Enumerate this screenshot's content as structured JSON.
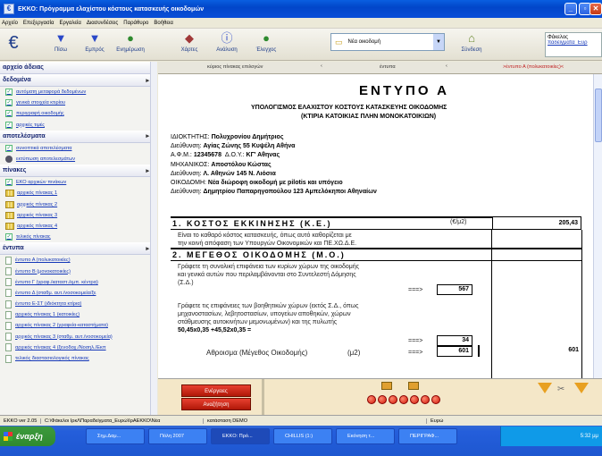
{
  "window": {
    "title": "ΕΚΚΟ: Πρόγραμμα ελαχίστου κόστους κατασκευής οικοδομών"
  },
  "menu": [
    "Αρχείο",
    "Επεξεργασία",
    "Εργαλεία",
    "Διασυνδέσεις",
    "Παράθυρο",
    "Βοήθεια"
  ],
  "toolbar": {
    "buttons": [
      {
        "label": "Πίσω",
        "icon": "back-arrow-icon"
      },
      {
        "label": "Εμπρός",
        "icon": "forward-arrow-icon"
      },
      {
        "label": "Ενημέρωση",
        "icon": "globe-icon"
      },
      {
        "label": "Χάρτες",
        "icon": "maps-icon"
      },
      {
        "label": "Ανάλυση",
        "icon": "info-icon"
      },
      {
        "label": "Έλεγχος",
        "icon": "check-icon"
      }
    ],
    "dropdown_value": "Νέα οικοδομή",
    "connect_label": "Σύνδεση",
    "folder_label": "Φάκελος",
    "folder_value": "παδείγματα_Ευρ"
  },
  "sidebar": {
    "sections": [
      {
        "title": "αρχείο άδειας",
        "items": []
      },
      {
        "title": "δεδομένα",
        "items": [
          {
            "label": "αυτόματη μεταφορά δεδομένων",
            "kind": "box"
          },
          {
            "label": "γενικά στοιχεία κτιρίου",
            "kind": "box"
          },
          {
            "label": "περιγραφή οικοδομής",
            "kind": "box"
          },
          {
            "label": "αρχικές τιμές",
            "kind": "box"
          }
        ]
      },
      {
        "title": "αποτελέσματα",
        "items": [
          {
            "label": "συνοπτικά αποτελέσματα",
            "kind": "box"
          },
          {
            "label": "εκτύπωση αποτελεσμάτων",
            "kind": "dot"
          }
        ]
      },
      {
        "title": "πίνακες",
        "items": [
          {
            "label": "ΕΚΟ αρχικών πινάκων",
            "kind": "box"
          },
          {
            "label": "αρχικός πίνακας 1",
            "kind": "grid"
          },
          {
            "label": "αρχικός πίνακας 2",
            "kind": "grid"
          },
          {
            "label": "αρχικός πίνακας 3",
            "kind": "grid"
          },
          {
            "label": "αρχικός πίνακας 4",
            "kind": "grid"
          },
          {
            "label": "τελικός πίνακας",
            "kind": "box"
          }
        ]
      },
      {
        "title": "έντυπα",
        "items": [
          {
            "label": "έντυπο Α (πολυκατοικίες)",
            "kind": "doc"
          },
          {
            "label": "έντυπο Β (μονοκατοικίες)",
            "kind": "doc"
          },
          {
            "label": "έντυπο Γ (γραφ./καταστ./εμπ. κέντρα)",
            "kind": "doc"
          },
          {
            "label": "έντυπο Δ (σταθμ. αυτ./νοσοκομεία/ξε",
            "kind": "doc"
          },
          {
            "label": "έντυπο Ε-ΣΤ (ιδιόκτητα κτίρια)",
            "kind": "doc"
          },
          {
            "label": "αρχικός πίνακας 1 (κατοικίες)",
            "kind": "doc"
          },
          {
            "label": "αρχικός πίνακας 2 (γραφεία-καταστήματα)",
            "kind": "doc"
          },
          {
            "label": "αρχικός πίνακας 3 (σταθμ. αυτ./νοσοκομεία)",
            "kind": "doc"
          },
          {
            "label": "αρχικός πίνακας 4 (ξενοδοχ./Νοσηλ./Εκπ",
            "kind": "doc"
          },
          {
            "label": "τελικός διαστασιολογικός πίνακας",
            "kind": "doc"
          }
        ]
      }
    ]
  },
  "tabs": {
    "t1": "κύριος πίνακας επιλογών",
    "t2": "έντυπα",
    "t3": ">έντυπο Α (πολυκατοικίες)<"
  },
  "form": {
    "title": "ΕΝΤΥΠΟ Α",
    "subtitle1": "ΥΠΟΛΟΓΙΣΜΟΣ ΕΛΑΧΙΣΤΟΥ ΚΟΣΤΟΥΣ ΚΑΤΑΣΚΕΥΗΣ ΟΙΚΟΔΟΜΗΣ",
    "subtitle2": "(ΚΤΙΡΙΑ ΚΑΤΟΙΚΙΑΣ ΠΛΗΝ ΜΟΝΟΚΑΤΟΙΚΙΩΝ)",
    "owner_label": "ΙΔΙΟΚΤΗΤΗΣ:",
    "owner": "Πολυχρονίου Δημήτριος",
    "addr_label": "Διεύθυνση:",
    "owner_addr": "Αγίας Ζώνης 55 Κυψέλη Αθήνα",
    "afm_label": "Α.Φ.Μ.:",
    "afm": "12345678",
    "doy_label": "Δ.Ο.Υ.:",
    "doy": "ΚΓ' Αθηνας",
    "eng_label": "ΜΗΧΑΝΙΚΟΣ:",
    "engineer": "Αποστόλου Κώστας",
    "eng_addr": "Λ. Αθηνών 145 Ν. Λιόσια",
    "build_label": "ΟΙΚΟΔΟΜΗ:",
    "building": "Νέα διώροφη οικοδομή με pilotis και υπόγειο",
    "build_addr": "Δημητρίου Παπαρηγοπούλου 123 Αμπελόκηποι Αθηναίων",
    "sec1_title": "1. ΚΟΣΤΟΣ ΕΚΚΙΝΗΣΗΣ (Κ.Ε.)",
    "sec1_unit": "(€/μ2)",
    "sec1_value": "205,43",
    "sec1_text1": "Είναι το καθαρό κόστος κατασκευής, όπως αυτό καθορίζεται με",
    "sec1_text2": "την κοινή απόφαση των Υπουργών Οικονομικών και ΠΕ.ΧΩ.Δ.Ε.",
    "sec2_title": "2. ΜΕΓΕΘΟΣ ΟΙΚΟΔΟΜΗΣ (Μ.Ο.)",
    "sec2_text1": "Γράφετε τη συνολική επιφάνεια των κυρίων χώρων της οικοδομής",
    "sec2_text2": "και γενικά αυτών που περιλαμβάνονται στο Συντελεστή Δόμησης",
    "sec2_text3": "(Σ.Δ.)",
    "arrow": "===>",
    "sec2_val1": "567",
    "sec2_text4": "Γράφετε τις επιφάνειες των βοηθητικών χώρων (εκτός Σ.Δ., όπως",
    "sec2_text5": "μηχανοστασίων, λεβητοστασίων, υπογείων αποθηκών, χώρων",
    "sec2_text6": "στάθμευσης αυτοκινήτων μεμονωμένων) και της πυλωτής",
    "sec2_formula": "50,45x0,35 +45,52x0,35 =",
    "sec2_val2": "34",
    "sum_label": "Αθροισμα (Μέγεθος Οικοδομής)",
    "sum_unit": "(μ2)",
    "sum_val": "601",
    "sum_total": "601"
  },
  "bottom": {
    "btn1": "Ενέργειες",
    "btn2": "Αναζήτηση"
  },
  "status": {
    "version": "EKKO ver 2.05",
    "path": "C:\\Φάκελοι ΙρκΛΠαραδείγματα_Ευρώ\\ΙρΑΕΚΚΟ\\Νέα",
    "mode": "κατάσταση DEMO",
    "currency": "Ευρώ"
  },
  "taskbar": {
    "start": "έναρξη",
    "tasks": [
      "Σημ.Δαμ...",
      "Πόλη 2007",
      "EKKO: Πρό...",
      "CHILLIS (1:)",
      "Εκόνηση τ...",
      "ΠΕΡΙΓΡΑΦ..."
    ],
    "clock": "5:32 μμ"
  }
}
